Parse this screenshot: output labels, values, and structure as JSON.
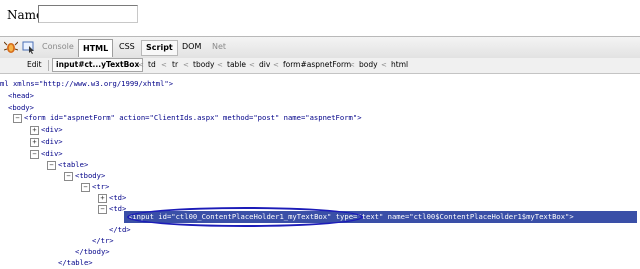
{
  "page": {
    "name_label": "Name:",
    "name_value": ""
  },
  "firebug": {
    "tabs": [
      {
        "label": "Console",
        "active": false
      },
      {
        "label": "HTML",
        "active": true
      },
      {
        "label": "CSS",
        "active": false
      },
      {
        "label": "Script",
        "active": false
      },
      {
        "label": "DOM",
        "active": false
      },
      {
        "label": "Net",
        "active": false
      }
    ],
    "edit_label": "Edit",
    "breadcrumb": [
      "input#ct...yTextBox",
      "td",
      "tr",
      "tbody",
      "table",
      "div",
      "form#aspnetForm",
      "body",
      "html"
    ]
  },
  "tree": {
    "line1": "ml xmlns=\"http://www.w3.org/1999/xhtml\">",
    "head": "<head>",
    "body": "<body>",
    "form_open": "<form id=\"aspnetForm\" action=\"ClientIds.aspx\" method=\"post\" name=\"aspnetForm\">",
    "div1": "<div>",
    "div2": "<div>",
    "div3": "<div>",
    "table_open": "<table>",
    "tbody_open": "<tbody>",
    "tr_open": "<tr>",
    "td1": "<td>",
    "td2": "<td>",
    "input_line": "<input id=\"ctl00_ContentPlaceHolder1_myTextBox\" type=\"text\" name=\"ctl00$ContentPlaceHolder1$myTextBox\">",
    "td_close": "</td>",
    "tr_close": "</tr>",
    "tbody_close": "</tbody>",
    "table_close": "</table>"
  },
  "colors": {
    "selection": "#3a4fa7",
    "tag": "#000088",
    "attr": "#882200",
    "value": "#0000ff",
    "annotation": "#1c1cb8"
  }
}
